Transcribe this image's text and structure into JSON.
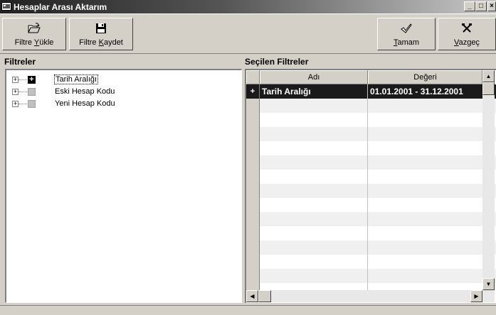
{
  "window": {
    "title": "Hesaplar Arası Aktarım",
    "icon": "app-window-icon"
  },
  "window_buttons": {
    "minimize": "_",
    "maximize": "□",
    "close": "×"
  },
  "toolbar": {
    "filtre_yukle": {
      "pre": "Filtre ",
      "hot": "Y",
      "post": "ükle",
      "icon": "folder-open-icon"
    },
    "filtre_kaydet": {
      "pre": "Filtre ",
      "hot": "K",
      "post": "aydet",
      "icon": "floppy-disk-icon"
    },
    "tamam": {
      "pre": "",
      "hot": "T",
      "post": "amam",
      "icon": "checkmark-icon"
    },
    "vazgec": {
      "pre": "",
      "hot": "V",
      "post": "azgeç",
      "icon": "cross-tools-icon"
    }
  },
  "filters_panel": {
    "label": "Filtreler",
    "items": [
      {
        "label": "Tarih Aralığı",
        "checked": true,
        "selected": true
      },
      {
        "label": "Eski Hesap Kodu",
        "checked": false,
        "selected": false
      },
      {
        "label": "Yeni Hesap Kodu",
        "checked": false,
        "selected": false
      }
    ]
  },
  "selected_panel": {
    "label": "Seçilen Filtreler",
    "columns": [
      "Adı",
      "Değeri"
    ],
    "rows": [
      {
        "indicator": "+",
        "name": "Tarih Aralığı",
        "value": "01.01.2001 - 31.12.2001"
      }
    ]
  },
  "scroll": {
    "up": "▲",
    "down": "▼",
    "left": "◀",
    "right": "▶"
  }
}
